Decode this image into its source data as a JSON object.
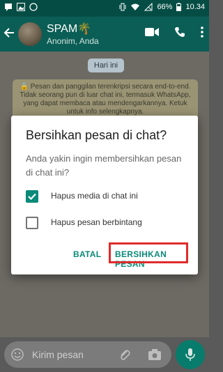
{
  "status_bar": {
    "battery": "66%",
    "time": "10.34",
    "icons": [
      "sms-icon",
      "gallery-icon",
      "whatsapp-icon",
      "vibrate-icon",
      "wifi-icon",
      "no-signal-icon",
      "battery-icon"
    ]
  },
  "header": {
    "title": "SPAM🌴",
    "subtitle": "Anonim, Anda",
    "actions": [
      "video-call-icon",
      "voice-call-icon",
      "more-options-icon"
    ]
  },
  "chat": {
    "date_chip": "Hari ini",
    "encryption_notice": "🔒 Pesan dan panggilan terenkripsi secara end-to-end. Tidak seorang pun di luar chat ini, termasuk WhatsApp, yang dapat membaca atau mendengarkannya. Ketuk untuk info selengkapnya."
  },
  "composer": {
    "placeholder": "Kirim pesan"
  },
  "dialog": {
    "title": "Bersihkan pesan di chat?",
    "message": "Anda yakin ingin membersihkan pesan di chat ini?",
    "options": [
      {
        "label": "Hapus media di chat ini",
        "checked": true
      },
      {
        "label": "Hapus pesan berbintang",
        "checked": false
      }
    ],
    "cancel_label": "BATAL",
    "confirm_label": "BERSIHKAN PESAN"
  },
  "colors": {
    "accent": "#0a8a78",
    "highlight": "#e02b2b",
    "header": "#0b5e55"
  }
}
